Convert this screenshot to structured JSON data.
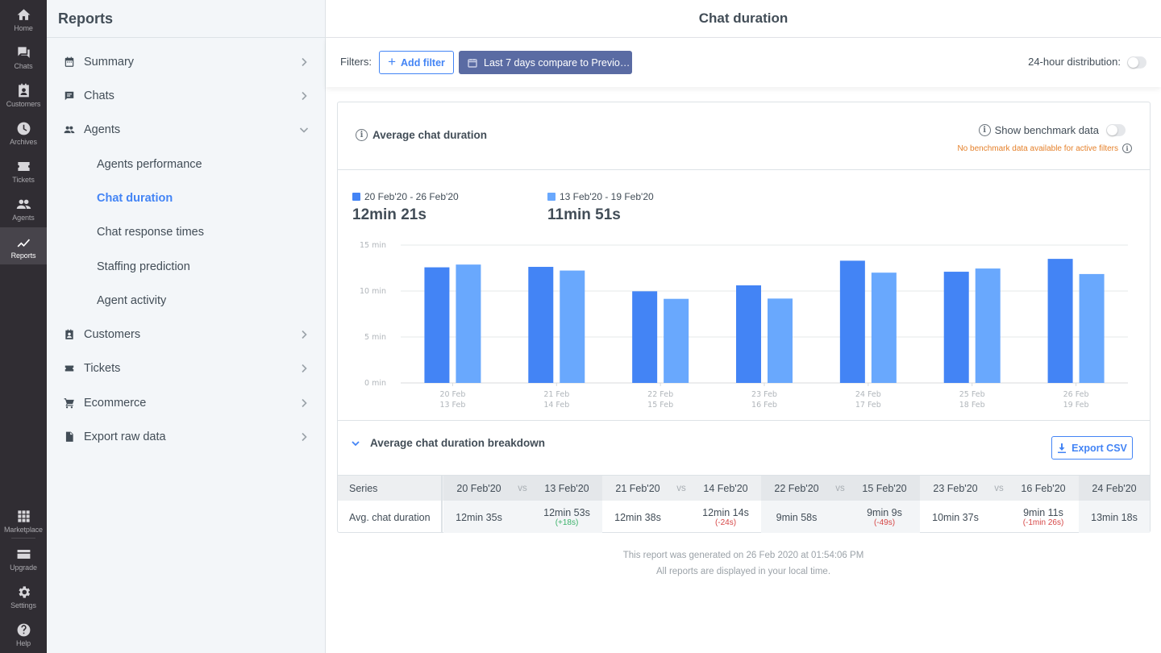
{
  "rail": {
    "top": [
      {
        "id": "home",
        "label": "Home",
        "icon": "home-icon"
      },
      {
        "id": "chats",
        "label": "Chats",
        "icon": "chats-icon"
      },
      {
        "id": "customers",
        "label": "Customers",
        "icon": "customers-icon"
      },
      {
        "id": "archives",
        "label": "Archives",
        "icon": "clock-icon"
      },
      {
        "id": "tickets",
        "label": "Tickets",
        "icon": "ticket-icon"
      },
      {
        "id": "agents",
        "label": "Agents",
        "icon": "agents-icon"
      },
      {
        "id": "reports",
        "label": "Reports",
        "icon": "chart-line-icon",
        "active": true
      }
    ],
    "bottom": [
      {
        "id": "marketplace",
        "label": "Marketplace",
        "icon": "grid-icon"
      },
      {
        "id": "upgrade",
        "label": "Upgrade",
        "icon": "card-icon"
      },
      {
        "id": "settings",
        "label": "Settings",
        "icon": "gear-icon"
      },
      {
        "id": "help",
        "label": "Help",
        "icon": "help-icon"
      }
    ]
  },
  "sidebar": {
    "title": "Reports",
    "items": [
      {
        "label": "Summary",
        "icon": "calendar-icon",
        "expanded": false
      },
      {
        "label": "Chats",
        "icon": "chat-icon",
        "expanded": false
      },
      {
        "label": "Agents",
        "icon": "agents-icon",
        "expanded": true,
        "children": [
          "Agents performance",
          "Chat duration",
          "Chat response times",
          "Staffing prediction",
          "Agent activity"
        ],
        "active_child": "Chat duration"
      },
      {
        "label": "Customers",
        "icon": "customer-card-icon",
        "expanded": false
      },
      {
        "label": "Tickets",
        "icon": "ticket-icon",
        "expanded": false
      },
      {
        "label": "Ecommerce",
        "icon": "cart-icon",
        "expanded": false
      },
      {
        "label": "Export raw data",
        "icon": "file-export-icon",
        "expanded": false
      }
    ]
  },
  "header": {
    "title": "Chat duration"
  },
  "filters": {
    "label": "Filters:",
    "add_filter": "Add filter",
    "date_range": "Last 7 days compare to Previo…",
    "distribution_label": "24-hour distribution:",
    "distribution_on": false
  },
  "card": {
    "title": "Average chat duration",
    "benchmark_label": "Show benchmark data",
    "benchmark_on": false,
    "benchmark_note": "No benchmark data available for active filters"
  },
  "summary": {
    "current": {
      "range": "20 Feb'20 - 26 Feb'20",
      "value": "12min 21s",
      "color": "#4384f5"
    },
    "previous": {
      "range": "13 Feb'20 - 19 Feb'20",
      "value": "11min 51s",
      "color": "#69a8fd"
    }
  },
  "chart_data": {
    "type": "bar",
    "title": "Average chat duration",
    "xlabel": "",
    "ylabel": "",
    "ylim": [
      0,
      15
    ],
    "y_ticks": [
      0,
      5,
      10,
      15
    ],
    "y_tick_labels": [
      "0 min",
      "5 min",
      "10 min",
      "15 min"
    ],
    "y_unit": "min",
    "grid": true,
    "categories": [
      "20 Feb",
      "21 Feb",
      "22 Feb",
      "23 Feb",
      "24 Feb",
      "25 Feb",
      "26 Feb"
    ],
    "categories_secondary": [
      "13 Feb",
      "14 Feb",
      "15 Feb",
      "16 Feb",
      "17 Feb",
      "18 Feb",
      "19 Feb"
    ],
    "series": [
      {
        "name": "20 Feb'20 - 26 Feb'20",
        "color": "#4384f5",
        "values": [
          12.58,
          12.63,
          9.97,
          10.62,
          13.3,
          12.1,
          13.5
        ]
      },
      {
        "name": "13 Feb'20 - 19 Feb'20",
        "color": "#69a8fd",
        "values": [
          12.88,
          12.23,
          9.15,
          9.18,
          12.0,
          12.45,
          11.85
        ]
      }
    ],
    "legend": "top-left"
  },
  "breakdown": {
    "title": "Average chat duration breakdown",
    "export_label": "Export CSV",
    "series_header": "Series",
    "series_name": "Avg. chat duration",
    "vs_label": "vs",
    "groups": [
      {
        "current_date": "20 Feb'20",
        "previous_date": "13 Feb'20",
        "current_value": "12min 35s",
        "previous_value": "12min 53s",
        "delta": "(+18s)",
        "delta_dir": "up"
      },
      {
        "current_date": "21 Feb'20",
        "previous_date": "14 Feb'20",
        "current_value": "12min 38s",
        "previous_value": "12min 14s",
        "delta": "(-24s)",
        "delta_dir": "down"
      },
      {
        "current_date": "22 Feb'20",
        "previous_date": "15 Feb'20",
        "current_value": "9min 58s",
        "previous_value": "9min 9s",
        "delta": "(-49s)",
        "delta_dir": "down"
      },
      {
        "current_date": "23 Feb'20",
        "previous_date": "16 Feb'20",
        "current_value": "10min 37s",
        "previous_value": "9min 11s",
        "delta": "(-1min 26s)",
        "delta_dir": "down"
      },
      {
        "current_date": "24 Feb'20",
        "previous_date": "",
        "current_value": "13min 18s",
        "previous_value": "",
        "delta": "",
        "delta_dir": ""
      }
    ]
  },
  "footer": {
    "generated": "This report was generated on 26 Feb 2020 at 01:54:06 PM",
    "timezone_note": "All reports are displayed in your local time."
  }
}
